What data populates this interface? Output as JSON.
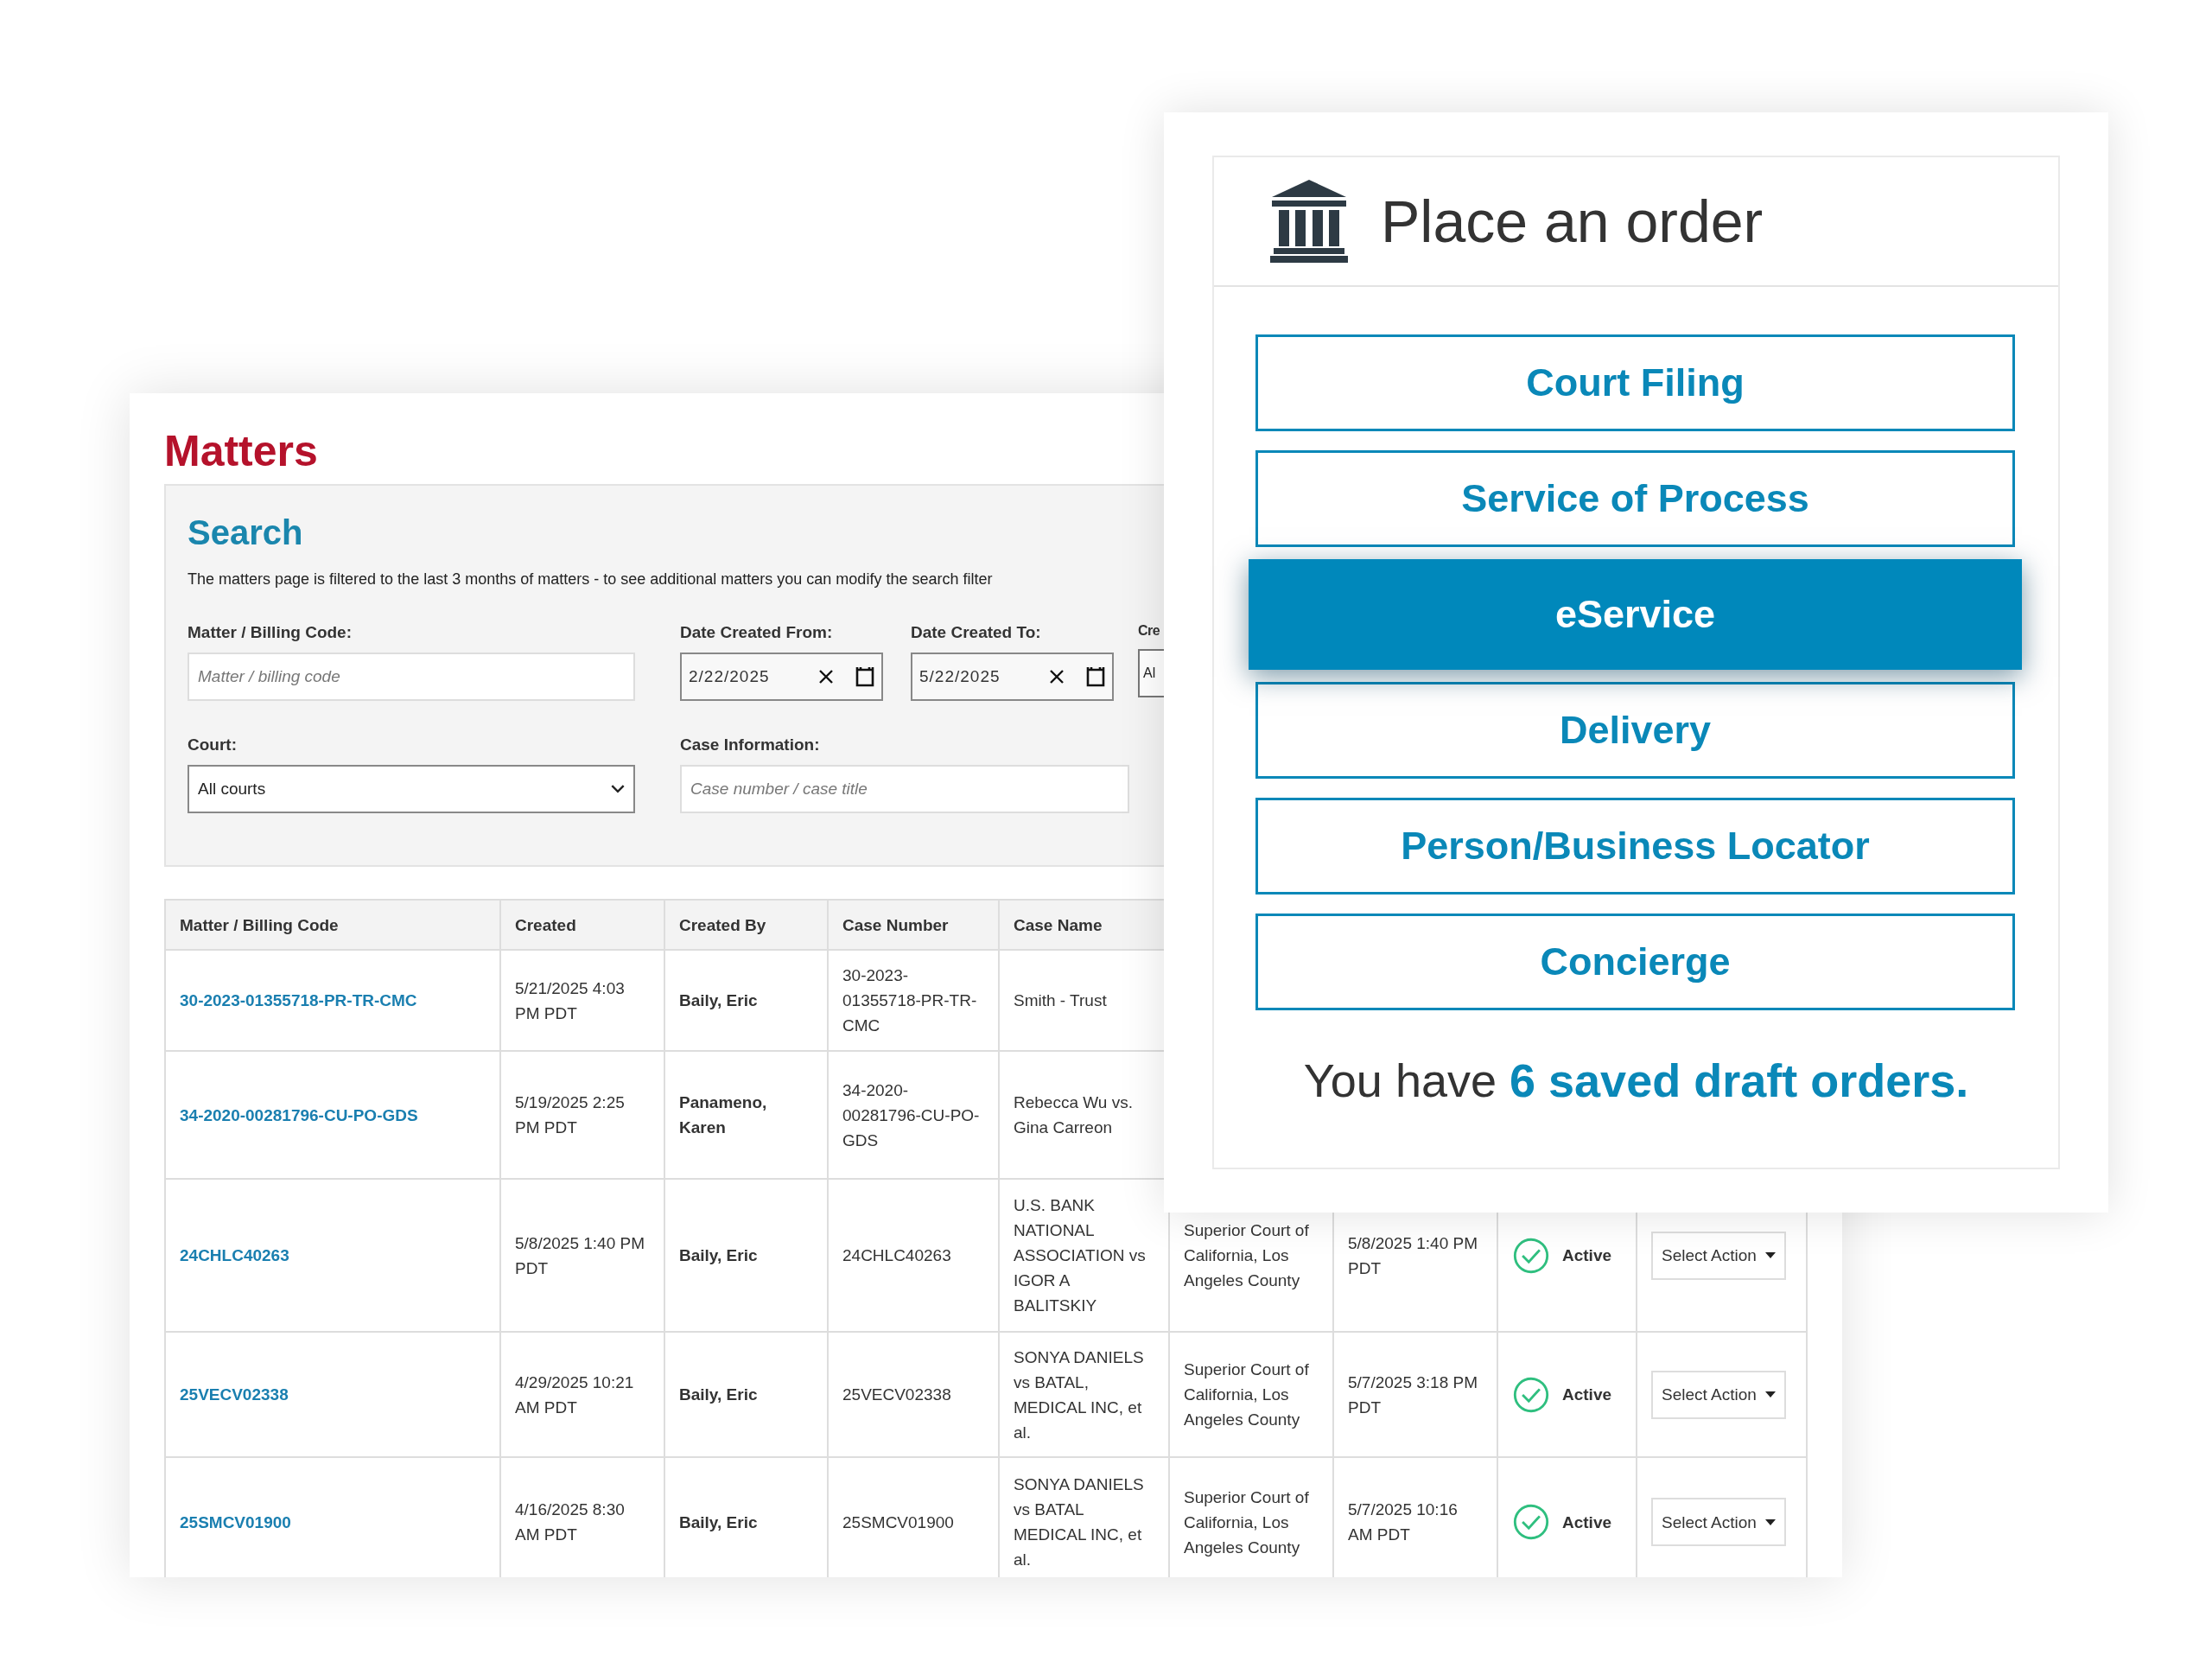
{
  "matters": {
    "title": "Matters",
    "search": {
      "title": "Search",
      "note": "The matters page is filtered to the last 3 months of matters - to see additional matters you can modify the search filter",
      "filter_rows": [
        [
          {
            "kind": "text",
            "label": "Matter / Billing Code:",
            "placeholder": "Matter / billing code"
          },
          {
            "kind": "date",
            "label": "Date Created From:",
            "value": "2/22/2025"
          },
          {
            "kind": "date",
            "label": "Date Created To:",
            "value": "5/22/2025"
          },
          {
            "kind": "field",
            "label": "Cre",
            "value": "Al"
          }
        ],
        [
          {
            "kind": "select",
            "label": "Court:",
            "value": "All courts"
          },
          {
            "kind": "text",
            "label": "Case Information:",
            "placeholder": "Case number / case title"
          }
        ]
      ]
    },
    "table": {
      "columns": [
        "Matter / Billing Code",
        "Created",
        "Created By",
        "Case Number",
        "Case Name"
      ],
      "rows": [
        {
          "code": "30-2023-01355718-PR-TR-CMC",
          "created": "5/21/2025 4:03 PM PDT",
          "created_by": "Baily, Eric",
          "case_number": "30-2023-01355718-PR-TR-CMC",
          "case_name": "Smith - Trust"
        },
        {
          "code": "34-2020-00281796-CU-PO-GDS",
          "created": "5/19/2025 2:25 PM PDT",
          "created_by": "Panameno, Karen",
          "case_number": "34-2020-00281796-CU-PO-GDS",
          "case_name": "Rebecca Wu vs. Gina Carreon"
        },
        {
          "code": "24CHLC40263",
          "created": "5/8/2025 1:40 PM PDT",
          "created_by": "Baily, Eric",
          "case_number": "24CHLC40263",
          "case_name": "U.S. BANK NATIONAL ASSOCIATION vs IGOR A BALITSKIY",
          "court": "Superior Court of California, Los Angeles County",
          "modified": "5/8/2025 1:40 PM PDT",
          "status": "Active",
          "action": "Select Action"
        },
        {
          "code": "25VECV02338",
          "created": "4/29/2025 10:21 AM PDT",
          "created_by": "Baily, Eric",
          "case_number": "25VECV02338",
          "case_name": "SONYA DANIELS vs BATAL, MEDICAL INC, et al.",
          "court": "Superior Court of California, Los Angeles County",
          "modified": "5/7/2025 3:18 PM PDT",
          "status": "Active",
          "action": "Select Action"
        },
        {
          "code": "25SMCV01900",
          "created": "4/16/2025 8:30 AM PDT",
          "created_by": "Baily, Eric",
          "case_number": "25SMCV01900",
          "case_name": "SONYA DANIELS vs BATAL MEDICAL INC, et al.",
          "court": "Superior Court of California, Los Angeles County",
          "modified": "5/7/2025 10:16 AM PDT",
          "status": "Active",
          "action": "Select Action"
        }
      ]
    }
  },
  "order_panel": {
    "title": "Place an order",
    "options": [
      {
        "label": "Court Filing",
        "selected": false
      },
      {
        "label": "Service of Process",
        "selected": false
      },
      {
        "label": "eService",
        "selected": true
      },
      {
        "label": "Delivery",
        "selected": false
      },
      {
        "label": "Person/Business Locator",
        "selected": false
      },
      {
        "label": "Concierge",
        "selected": false
      }
    ],
    "drafts_prefix": "You have",
    "drafts_link": "6 saved draft orders."
  }
}
